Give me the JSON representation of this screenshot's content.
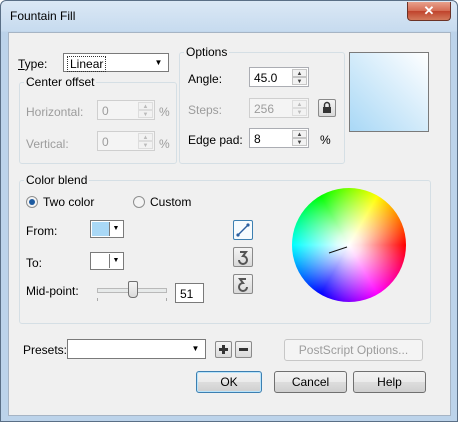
{
  "window": {
    "title": "Fountain Fill",
    "close_glyph": "✕"
  },
  "type": {
    "label": "Type:",
    "value": "Linear"
  },
  "center_offset": {
    "group_label": "Center offset",
    "horizontal": {
      "label": "Horizontal:",
      "value": "0",
      "unit": "%"
    },
    "vertical": {
      "label": "Vertical:",
      "value": "0",
      "unit": "%"
    }
  },
  "options": {
    "group_label": "Options",
    "angle": {
      "label": "Angle:",
      "value": "45.0"
    },
    "steps": {
      "label": "Steps:",
      "value": "256"
    },
    "edge_pad": {
      "label": "Edge pad:",
      "value": "8",
      "unit": "%"
    }
  },
  "color_blend": {
    "group_label": "Color blend",
    "two_color": {
      "label": "Two color",
      "selected": true
    },
    "custom": {
      "label": "Custom",
      "selected": false
    },
    "from": {
      "label": "From:",
      "color": "#a9d8f6"
    },
    "to": {
      "label": "To:",
      "color": "#ffffff"
    },
    "midpoint": {
      "label": "Mid-point:",
      "value": "51",
      "fraction": 0.51
    }
  },
  "preview": {
    "color_start": "#a9d8f6",
    "color_end": "#ffffff"
  },
  "presets": {
    "label": "Presets:",
    "value": ""
  },
  "buttons": {
    "postscript": "PostScript Options...",
    "ok": "OK",
    "cancel": "Cancel",
    "help": "Help"
  },
  "icons": [
    "lock-icon",
    "direct-blend-icon",
    "counterclockwise-blend-icon",
    "clockwise-blend-icon",
    "add-preset-icon",
    "remove-preset-icon",
    "dropdown-arrow-icon"
  ]
}
